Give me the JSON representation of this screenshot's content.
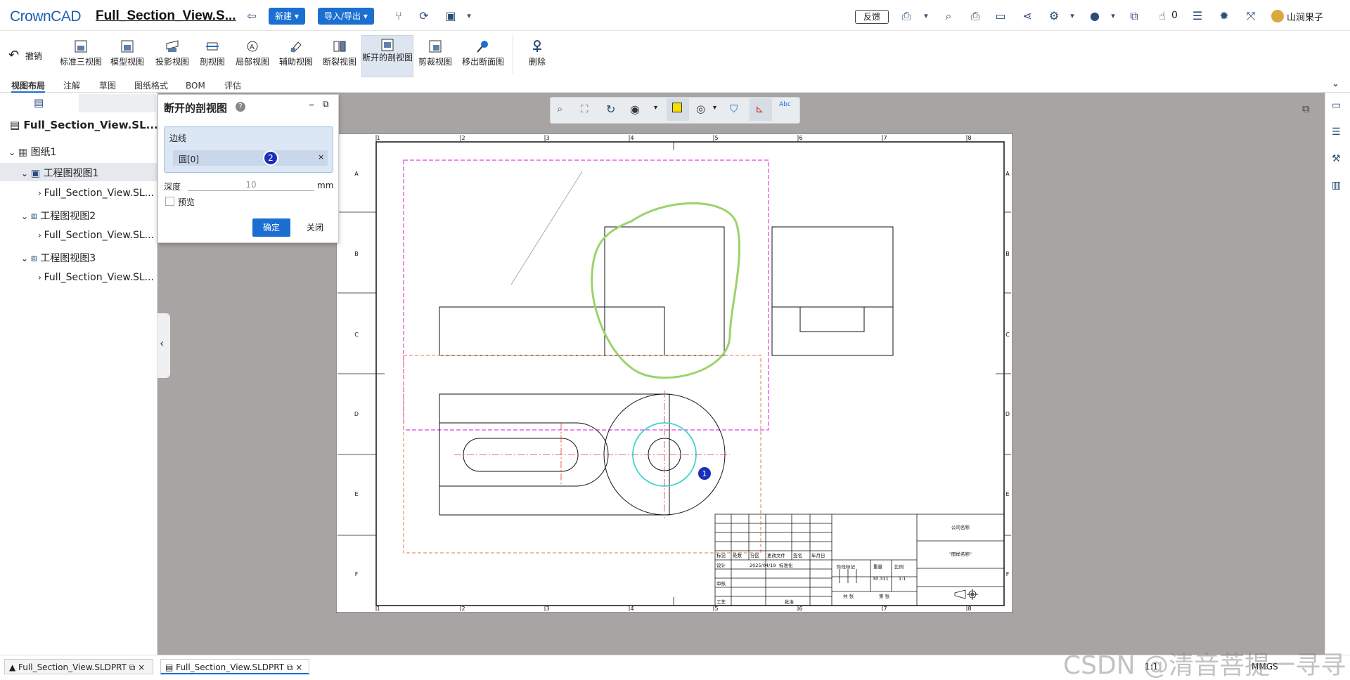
{
  "app": {
    "logo": "CrownCAD",
    "doc_title": "Full_Section_View.S...",
    "btn_new": "新建",
    "btn_import": "导入/导出",
    "feedback": "反馈",
    "like_count": "0",
    "user": "山涧果子"
  },
  "ribbon": {
    "undo": "撤销",
    "items": [
      "标准三视图",
      "模型视图",
      "投影视图",
      "剖视图",
      "局部视图",
      "辅助视图",
      "断裂视图",
      "断开的剖视图",
      "剪裁视图",
      "移出断面图",
      "删除"
    ]
  },
  "tabs": [
    "视图布局",
    "注解",
    "草图",
    "图纸格式",
    "BOM",
    "评估"
  ],
  "tree": {
    "root": "Full_Section_View.SL...",
    "sheet": "图纸1",
    "views": [
      {
        "label": "工程图视图1",
        "child": "Full_Section_View.SL..."
      },
      {
        "label": "工程图视图2",
        "child": "Full_Section_View.SL..."
      },
      {
        "label": "工程图视图3",
        "child": "Full_Section_View.SL..."
      }
    ]
  },
  "dialog": {
    "title": "断开的剖视图",
    "edge_label": "边线",
    "edge_value": "圆[0]",
    "marker2": "2",
    "depth_label": "深度",
    "depth_value": "10",
    "depth_unit": "mm",
    "preview_label": "预览",
    "ok": "确定",
    "close": "关闭"
  },
  "drawing": {
    "marker1": "1",
    "cols": [
      "1",
      "2",
      "3",
      "4",
      "5",
      "6",
      "7",
      "8"
    ],
    "rows": [
      "A",
      "B",
      "C",
      "D",
      "E",
      "F"
    ],
    "tb": {
      "company": "公司名称",
      "drawing_name": "\"图样名称\"",
      "mark": "标记",
      "count": "处数",
      "zone": "分区",
      "change_doc": "更改文件",
      "sign": "签名",
      "date": "年月日",
      "design": "设计",
      "date_val": "2025/04/19",
      "std": "标准化",
      "stage": "阶段标记",
      "weight": "重量",
      "scale": "比例",
      "weight_val": "30.311",
      "scale_val": "1:1",
      "review": "审核",
      "process": "工艺",
      "approve": "批准",
      "total": "共 张",
      "page": "第 张"
    }
  },
  "bottom": {
    "tab1": "Full_Section_View.SLDPRT",
    "tab2": "Full_Section_View.SLDPRT",
    "scale": "1:1",
    "units": "MMGS",
    "watermark": "CSDN @清音菩提一寻寻"
  },
  "colors": {
    "accent": "#1b6fd1",
    "canvas": "#a8a4a4",
    "green_curve": "#9bd36b",
    "cyan_circle": "#3fd6c8",
    "magenta_box": "#e040e0",
    "orange_box": "#f07050"
  }
}
